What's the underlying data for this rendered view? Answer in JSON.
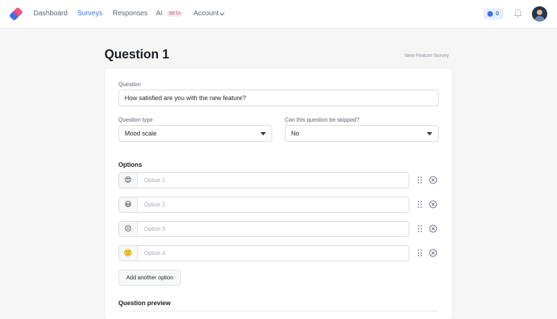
{
  "nav": {
    "items": [
      "Dashboard",
      "Surveys",
      "Responses",
      "AI"
    ],
    "beta_badge": "BETA",
    "account_label": "Account",
    "credits": "0",
    "active_color": "#3b6ff0"
  },
  "page": {
    "title": "Question 1",
    "survey_name": "New Feature Survey"
  },
  "form": {
    "question_label": "Question",
    "question_value": "How satisfied are you with the new feature?",
    "type_label": "Question type",
    "type_value": "Mood scale",
    "skip_label": "Can this question be skipped?",
    "skip_value": "No",
    "options_label": "Options",
    "options": [
      {
        "emoji": "😍",
        "placeholder": "Option 1"
      },
      {
        "emoji": "😃",
        "placeholder": "Option 2"
      },
      {
        "emoji": "😐",
        "placeholder": "Option 3"
      },
      {
        "emoji": "🙁",
        "placeholder": "Option 4"
      }
    ],
    "add_option_label": "Add another option",
    "preview_label": "Question preview"
  },
  "icons": {
    "logo": "app-logo-icon",
    "credits": "credits-icon",
    "bell": "bell-icon",
    "drag": "drag-handle-icon",
    "remove": "remove-circle-icon",
    "dropdown": "caret-down-icon"
  }
}
